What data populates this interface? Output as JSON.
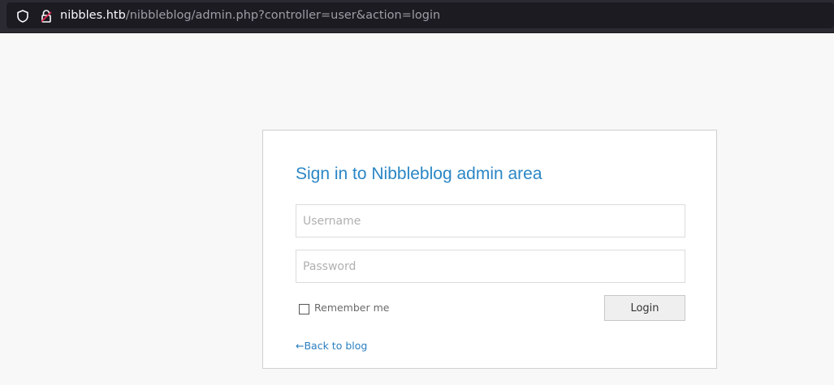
{
  "browser": {
    "url_host": "nibbles.htb",
    "url_path": "/nibbleblog/admin.php?controller=user&action=login",
    "icons": [
      "shield-icon",
      "lock-icon"
    ]
  },
  "login": {
    "title": "Sign in to Nibbleblog admin area",
    "username_placeholder": "Username",
    "username_value": "",
    "password_placeholder": "Password",
    "password_value": "",
    "remember_label": "Remember me",
    "remember_checked": false,
    "login_button": "Login",
    "back_link": "←Back to blog"
  },
  "colors": {
    "accent": "#2a86c5",
    "urlbar_bg": "#2b2a33",
    "page_bg": "#f8f8f8"
  }
}
